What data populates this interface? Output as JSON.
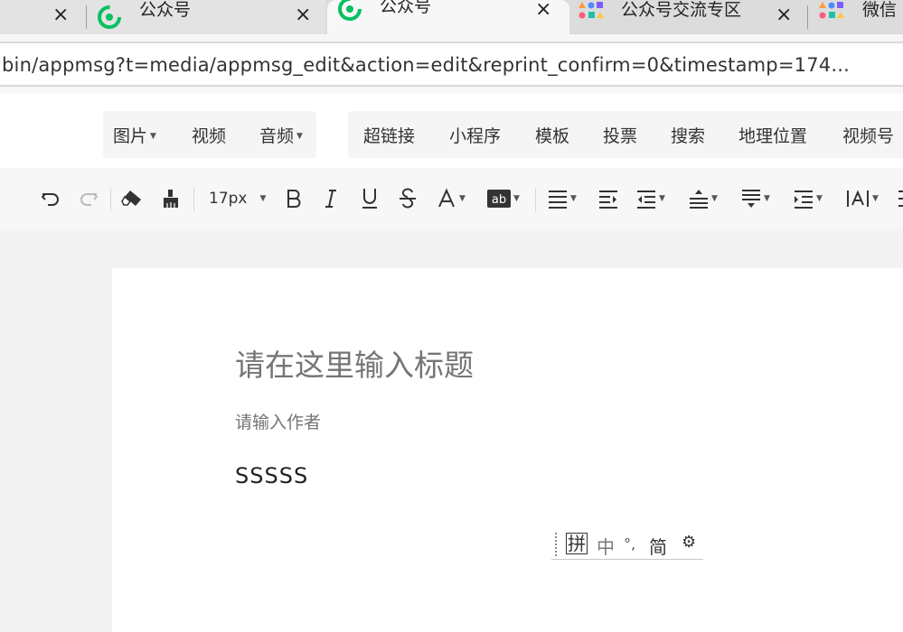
{
  "tabs": [
    {
      "title": "公众号",
      "close": "×",
      "icon": "wechat-mp-icon"
    },
    {
      "title": "公众号",
      "close": "×",
      "icon": "wechat-mp-icon",
      "active": true
    },
    {
      "title": "公众号交流专区",
      "close": "×",
      "icon": "community-icon"
    },
    {
      "title": "微信",
      "icon": "community-icon"
    }
  ],
  "first_tab_close": "×",
  "address_bar": {
    "url": "bin/appmsg?t=media/appmsg_edit&action=edit&reprint_confirm=0&timestamp=174..."
  },
  "media_toolbar": {
    "group1": [
      {
        "label": "图片",
        "dropdown": true
      },
      {
        "label": "视频",
        "dropdown": false
      },
      {
        "label": "音频",
        "dropdown": true
      }
    ],
    "group2": [
      {
        "label": "超链接"
      },
      {
        "label": "小程序"
      },
      {
        "label": "模板"
      },
      {
        "label": "投票"
      },
      {
        "label": "搜索"
      },
      {
        "label": "地理位置"
      },
      {
        "label": "视频号"
      }
    ]
  },
  "format_toolbar": {
    "font_size": "17px",
    "icons": [
      "undo-icon",
      "redo-icon",
      "eraser-icon",
      "format-painter-icon",
      "bold-icon",
      "italic-icon",
      "underline-icon",
      "strikethrough-icon",
      "font-color-icon",
      "background-color-icon",
      "align-icon",
      "indent-icon",
      "outdent-icon",
      "line-height-icon",
      "paragraph-spacing-icon",
      "list-indent-icon",
      "letter-spacing-icon"
    ]
  },
  "editor": {
    "title_placeholder": "请在这里输入标题",
    "author_placeholder": "请输入作者",
    "body_text": "SSSSS"
  },
  "ime_bar": {
    "keys": [
      "拼",
      "中",
      "°,",
      "简",
      "⚙"
    ]
  },
  "colors": {
    "tab_inactive": "#dcdcdc",
    "tab_active": "#f7f7f7",
    "toolbar_group_bg": "#f5f5f5",
    "paper_bg": "#ffffff",
    "placeholder": "#a5a5a5",
    "wechat_green": "#07c160"
  }
}
